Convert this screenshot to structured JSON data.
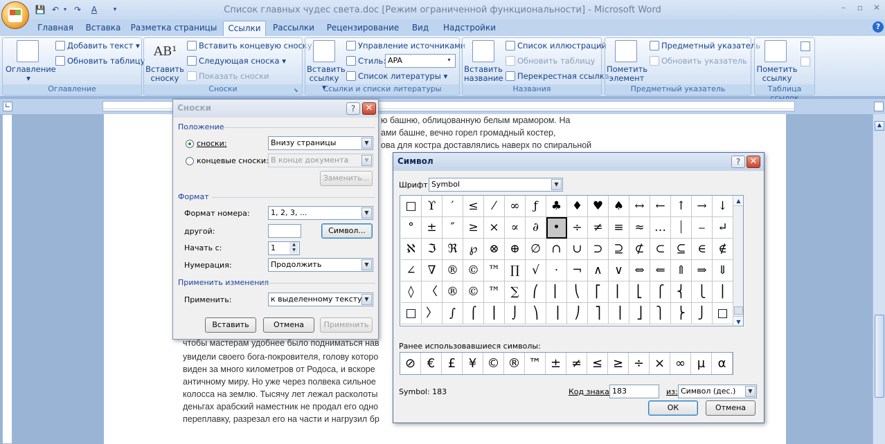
{
  "window": {
    "title": "Список главных чудес света.doc [Режим ограниченной функциональности] - Microsoft Word"
  },
  "tabs": [
    "Главная",
    "Вставка",
    "Разметка страницы",
    "Ссылки",
    "Рассылки",
    "Рецензирование",
    "Вид",
    "Надстройки"
  ],
  "ribbon": {
    "toc": {
      "label": "Оглавление",
      "add_text": "Добавить текст",
      "update_table": "Обновить таблицу",
      "group": "Оглавление"
    },
    "footnotes": {
      "insert": "Вставить сноску",
      "insert_end": "Вставить концевую сноску",
      "next": "Следующая сноска",
      "show": "Показать сноски",
      "group": "Сноски",
      "ab_icon": "AB¹"
    },
    "citations": {
      "insert": "Вставить ссылку",
      "manage": "Управление источниками",
      "style_label": "Стиль:",
      "style_value": "APA",
      "bibliography": "Список литературы",
      "group": "Ссылки и списки литературы"
    },
    "captions": {
      "insert": "Вставить название",
      "figures": "Список иллюстраций",
      "update": "Обновить таблицу",
      "cross": "Перекрестная ссылка",
      "group": "Названия"
    },
    "index": {
      "mark": "Пометить элемент",
      "insert": "Предметный указатель",
      "update": "Обновить указатель",
      "group": "Предметный указатель"
    },
    "toa": {
      "mark": "Пометить ссылку",
      "group": "Таблица ссылок"
    }
  },
  "document": {
    "lines": [
      "ю башню, облицованную белым мрамором. На",
      "ами башне, вечно горел громадный костер,",
      "ова для костра доставлялись наверх по спиральной",
      "чтобы мастерам удобнее было подниматься нав",
      "увидели своего бога-покровителя, голову которо",
      "виден за много километров от Родоса, и вскоре",
      "античному миру. Но уже через полвека сильное",
      "колосса на землю. Тысячу лет лежал расколоты",
      "деньгах арабский наместник не продал его одно",
      "переплавку, разрезал его на части и нагрузил бр"
    ]
  },
  "footnote_dialog": {
    "title": "Сноски",
    "position_section": "Положение",
    "footnotes_label": "сноски:",
    "footnotes_value": "Внизу страницы",
    "endnotes_label": "концевые сноски:",
    "endnotes_value": "В конце документа",
    "replace_btn": "Заменить...",
    "format_section": "Формат",
    "number_format_label": "Формат номера:",
    "number_format_value": "1, 2, 3, ...",
    "custom_label": "другой:",
    "custom_value": "",
    "symbol_btn": "Символ...",
    "start_label": "Начать с:",
    "start_value": "1",
    "numbering_label": "Нумерация:",
    "numbering_value": "Продолжить",
    "apply_section": "Применить изменения",
    "apply_label": "Применить:",
    "apply_value": "к выделенному тексту",
    "insert_btn": "Вставить",
    "cancel_btn": "Отмена",
    "apply_btn": "Применить"
  },
  "symbol_dialog": {
    "title": "Символ",
    "font_label": "Шрифт:",
    "font_value": "Symbol",
    "grid": [
      [
        "□",
        "ϒ",
        "′",
        "≤",
        "⁄",
        "∞",
        "ƒ",
        "♣",
        "♦",
        "♥",
        "♠",
        "↔",
        "←",
        "↑",
        "→",
        "↓"
      ],
      [
        "°",
        "±",
        "″",
        "≥",
        "×",
        "∝",
        "∂",
        "•",
        "÷",
        "≠",
        "≡",
        "≈",
        "…",
        "⏐",
        "⎯",
        "↵"
      ],
      [
        "ℵ",
        "ℑ",
        "ℜ",
        "℘",
        "⊗",
        "⊕",
        "∅",
        "∩",
        "∪",
        "⊃",
        "⊇",
        "⊄",
        "⊂",
        "⊆",
        "∈",
        "∉"
      ],
      [
        "∠",
        "∇",
        "®",
        "©",
        "™",
        "∏",
        "√",
        "⋅",
        "¬",
        "∧",
        "∨",
        "⇔",
        "⇐",
        "⇑",
        "⇒",
        "⇓"
      ],
      [
        "◊",
        "〈",
        "®",
        "©",
        "™",
        "∑",
        "⎛",
        "⎜",
        "⎝",
        "⎡",
        "⎢",
        "⎣",
        "⎧",
        "⎨",
        "⎩",
        "⎪"
      ],
      [
        "□",
        "〉",
        "∫",
        "⌠",
        "⎮",
        "⌡",
        "⎞",
        "⎟",
        "⎠",
        "⎤",
        "⎥",
        "⎦",
        "⎫",
        "⎬",
        "⎭",
        "□"
      ]
    ],
    "selected": "•",
    "recent_label": "Ранее использовавшиеся символы:",
    "recent": [
      "⊘",
      "€",
      "£",
      "¥",
      "©",
      "®",
      "™",
      "±",
      "≠",
      "≤",
      "≥",
      "÷",
      "×",
      "∞",
      "µ",
      "α"
    ],
    "status": "Symbol: 183",
    "code_label": "Код знака:",
    "code_value": "183",
    "from_label": "из:",
    "from_value": "Символ (дес.)",
    "ok_btn": "ОК",
    "cancel_btn": "Отмена"
  }
}
